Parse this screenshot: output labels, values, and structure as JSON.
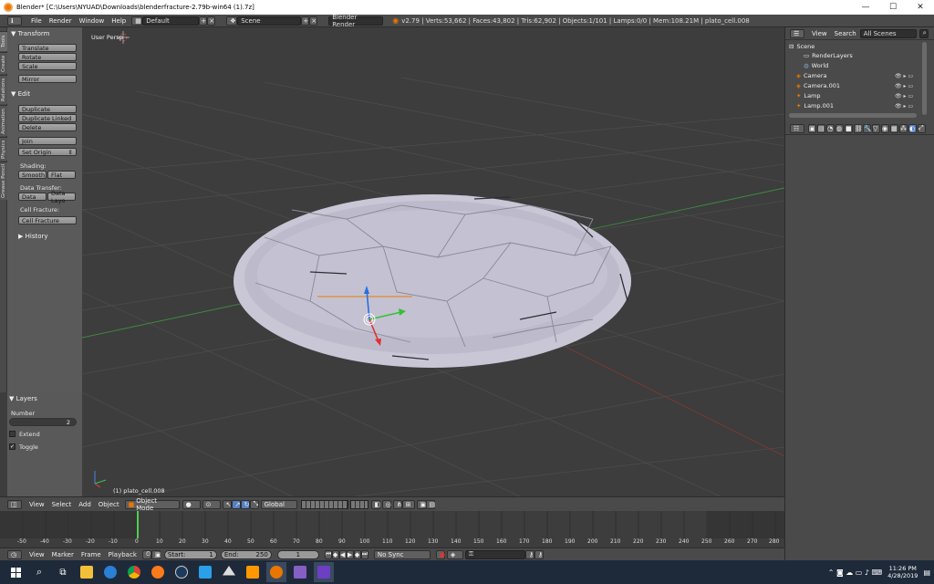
{
  "window": {
    "title": "Blender* [C:\\Users\\NYUAD\\Downloads\\blenderfracture-2.79b-win64 (1).7z]",
    "minimize": "—",
    "maximize": "☐",
    "close": "✕"
  },
  "info_header": {
    "menus": [
      "File",
      "Render",
      "Window",
      "Help"
    ],
    "screen_layout": "Default",
    "scene": "Scene",
    "render_engine": "Blender Render",
    "stats": "v2.79 | Verts:53,662 | Faces:43,802 | Tris:62,902 | Objects:1/101 | Lamps:0/0 | Mem:108.21M | plato_cell.008"
  },
  "tool_tabs": [
    "Tools",
    "Create",
    "Relations",
    "Animation",
    "Physics",
    "Grease Pencil"
  ],
  "tool_shelf": {
    "transform_header": "Transform",
    "translate": "Translate",
    "rotate": "Rotate",
    "scale": "Scale",
    "mirror": "Mirror",
    "edit_header": "Edit",
    "duplicate": "Duplicate",
    "duplicate_linked": "Duplicate Linked",
    "delete": "Delete",
    "join": "Join",
    "set_origin": "Set Origin",
    "shading_label": "Shading:",
    "smooth": "Smooth",
    "flat": "Flat",
    "data_transfer_label": "Data Transfer:",
    "data": "Data",
    "data_layo": "Data Layo",
    "cell_fracture_label": "Cell Fracture:",
    "cell_fracture": "Cell Fracture",
    "history_header": "History"
  },
  "layers_panel": {
    "header": "Layers",
    "number_label": "Number",
    "number_value": "2",
    "extend": "Extend",
    "toggle": "Toggle"
  },
  "viewport": {
    "view_label": "User Persp",
    "object_label": "(1) plato_cell.008"
  },
  "view3d_header": {
    "menus": [
      "View",
      "Select",
      "Add",
      "Object"
    ],
    "mode": "Object Mode",
    "orientation": "Global"
  },
  "timeline": {
    "ticks": [
      "-50",
      "-40",
      "-30",
      "-20",
      "-10",
      "0",
      "10",
      "20",
      "30",
      "40",
      "50",
      "60",
      "70",
      "80",
      "90",
      "100",
      "110",
      "120",
      "130",
      "140",
      "150",
      "160",
      "170",
      "180",
      "190",
      "200",
      "210",
      "220",
      "230",
      "240",
      "250",
      "260",
      "270",
      "280"
    ],
    "menus": [
      "View",
      "Marker",
      "Frame",
      "Playback"
    ],
    "start": "Start:",
    "start_val": "1",
    "end": "End:",
    "end_val": "250",
    "current": "1",
    "sync": "No Sync"
  },
  "outliner": {
    "view": "View",
    "search": "Search",
    "filter": "All Scenes",
    "rows": [
      "Scene",
      "RenderLayers",
      "World",
      "Camera",
      "Camera.001",
      "Lamp",
      "Lamp.001"
    ]
  },
  "taskbar": {
    "time": "11:26 PM",
    "date": "4/28/2019"
  },
  "colors": {
    "object_fill": "#c9c7d6",
    "grid_line": "#4a4a4a",
    "x_axis": "#8c3a3a",
    "y_axis": "#3f8a3f",
    "accent_orange": "#ea7600"
  }
}
